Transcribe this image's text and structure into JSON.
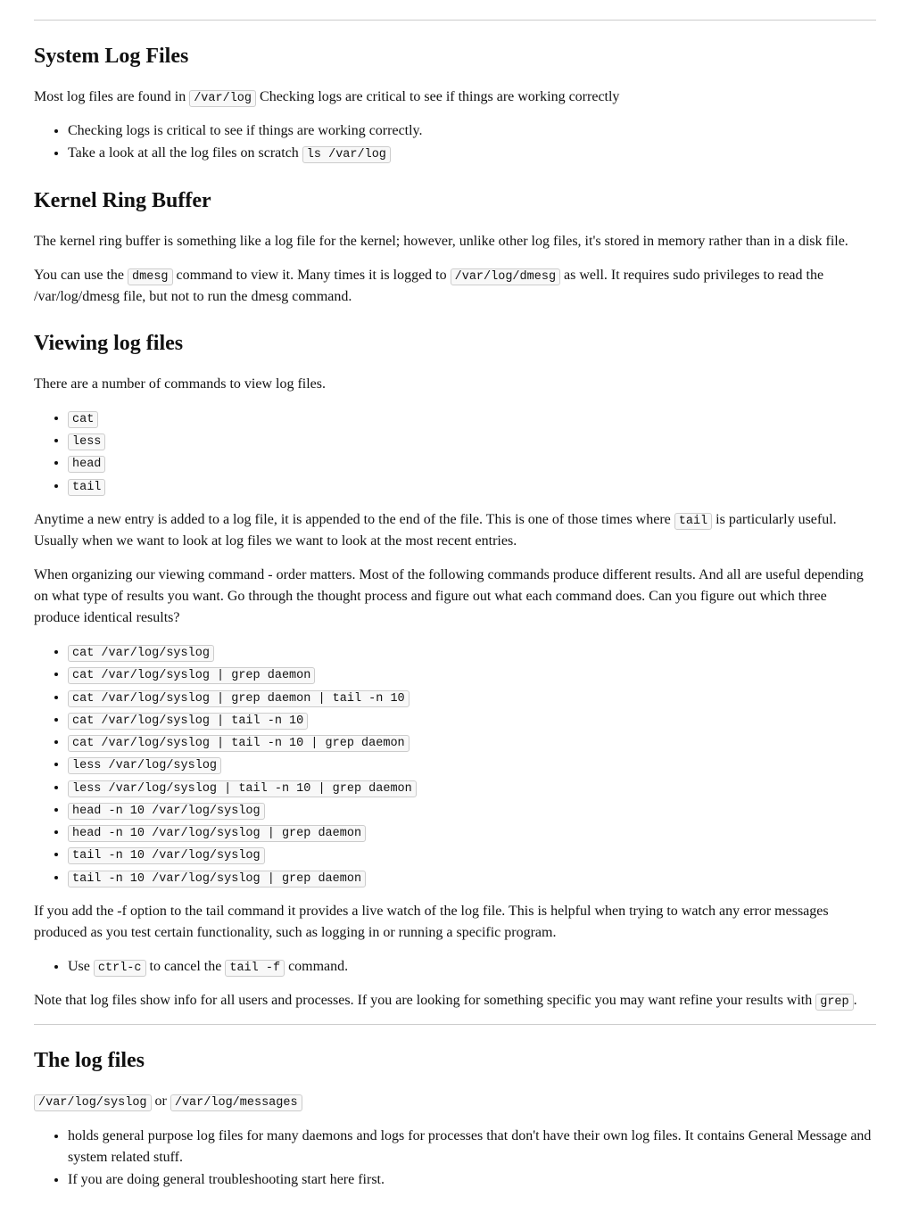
{
  "section1": {
    "heading": "System Log Files",
    "intro_part1": "Most log files are found in ",
    "intro_code": "/var/log",
    "intro_part2": " Checking logs are critical to see if things are working correctly",
    "bullets": [
      {
        "text": "Checking logs is critical to see if things are working correctly."
      },
      {
        "text_pre": "Take a look at all the log files on scratch ",
        "code": "ls /var/log"
      }
    ]
  },
  "section2": {
    "heading": "Kernel Ring Buffer",
    "p1": "The kernel ring buffer is something like a log file for the kernel; however, unlike other log files, it's stored in memory rather than in a disk file.",
    "p2_a": "You can use the ",
    "p2_code1": "dmesg",
    "p2_b": " command to view it. Many times it is logged to ",
    "p2_code2": "/var/log/dmesg",
    "p2_c": " as well. It requires sudo privileges to read the /var/log/dmesg file, but not to run the dmesg command."
  },
  "section3": {
    "heading": "Viewing log files",
    "p1": "There are a number of commands to view log files.",
    "cmds": [
      "cat",
      "less",
      "head",
      "tail"
    ],
    "p2_a": "Anytime a new entry is added to a log file, it is appended to the end of the file. This is one of those times where ",
    "p2_code": "tail",
    "p2_b": " is particularly useful. Usually when we want to look at log files we want to look at the most recent entries.",
    "p3": "When organizing our viewing command - order matters. Most of the following commands produce different results. And all are useful depending on what type of results you want. Go through the thought process and figure out what each command does. Can you figure out which three produce identical results?",
    "examples": [
      "cat /var/log/syslog",
      "cat /var/log/syslog | grep daemon",
      "cat /var/log/syslog | grep daemon | tail -n 10",
      "cat /var/log/syslog | tail -n 10",
      "cat /var/log/syslog | tail -n 10 | grep daemon",
      "less /var/log/syslog",
      "less /var/log/syslog | tail -n 10 | grep daemon",
      "head -n 10 /var/log/syslog",
      "head -n 10 /var/log/syslog | grep daemon",
      "tail -n 10 /var/log/syslog",
      "tail -n 10 /var/log/syslog | grep daemon"
    ],
    "p4": "If you add the -f option to the tail command it provides a live watch of the log file. This is helpful when trying to watch any error messages produced as you test certain functionality, such as logging in or running a specific program.",
    "bullet_use_a": "Use ",
    "bullet_use_code1": "ctrl-c",
    "bullet_use_b": " to cancel the ",
    "bullet_use_code2": "tail -f",
    "bullet_use_c": " command.",
    "p5_a": "Note that log files show info for all users and processes. If you are looking for something specific you may want refine your results with ",
    "p5_code": "grep",
    "p5_b": "."
  },
  "section4": {
    "heading": "The log files",
    "line_code1": "/var/log/syslog",
    "line_or": " or ",
    "line_code2": "/var/log/messages",
    "bullets": [
      "holds general purpose log files for many daemons and logs for processes that don't have their own log files. It contains General Message and system related stuff.",
      "If you are doing general troubleshooting start here first."
    ]
  }
}
